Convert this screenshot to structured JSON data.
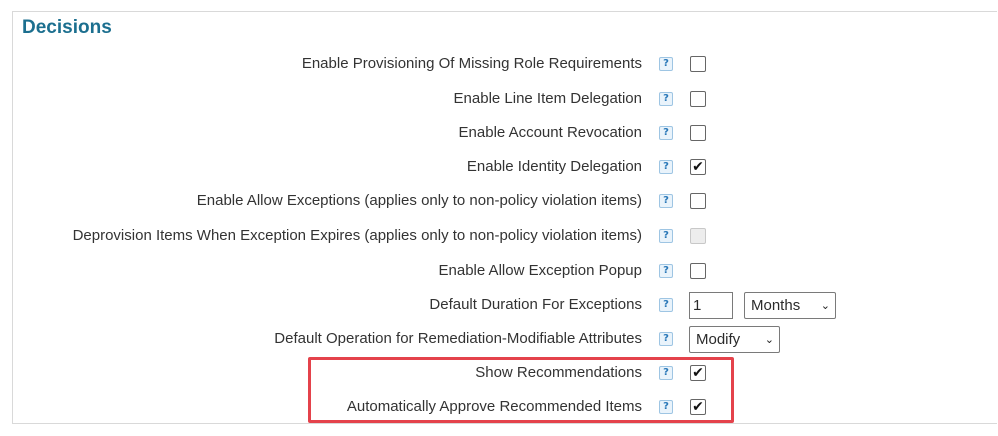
{
  "section": {
    "title": "Decisions"
  },
  "help_glyph": "?",
  "check_glyph": "✔",
  "settings": [
    {
      "label": "Enable Provisioning Of Missing Role Requirements",
      "control": "checkbox",
      "checked": false
    },
    {
      "label": "Enable Line Item Delegation",
      "control": "checkbox",
      "checked": false
    },
    {
      "label": "Enable Account Revocation",
      "control": "checkbox",
      "checked": false
    },
    {
      "label": "Enable Identity Delegation",
      "control": "checkbox",
      "checked": true
    },
    {
      "label": "Enable Allow Exceptions (applies only to non-policy violation items)",
      "control": "checkbox",
      "checked": false
    },
    {
      "label": "Deprovision Items When Exception Expires (applies only to non-policy violation items)",
      "control": "checkbox",
      "checked": false,
      "disabled": true
    },
    {
      "label": "Enable Allow Exception Popup",
      "control": "checkbox",
      "checked": false
    },
    {
      "label": "Default Duration For Exceptions",
      "control": "duration",
      "value": "1",
      "unit": "Months"
    },
    {
      "label": "Default Operation for Remediation-Modifiable Attributes",
      "control": "select",
      "value": "Modify"
    },
    {
      "label": "Show Recommendations",
      "control": "checkbox",
      "checked": true
    },
    {
      "label": "Automatically Approve Recommended Items",
      "control": "checkbox",
      "checked": true
    }
  ],
  "colors": {
    "title": "#1c6f8f",
    "highlight": "#e4424b",
    "help_bg": "#e9f3fb"
  }
}
